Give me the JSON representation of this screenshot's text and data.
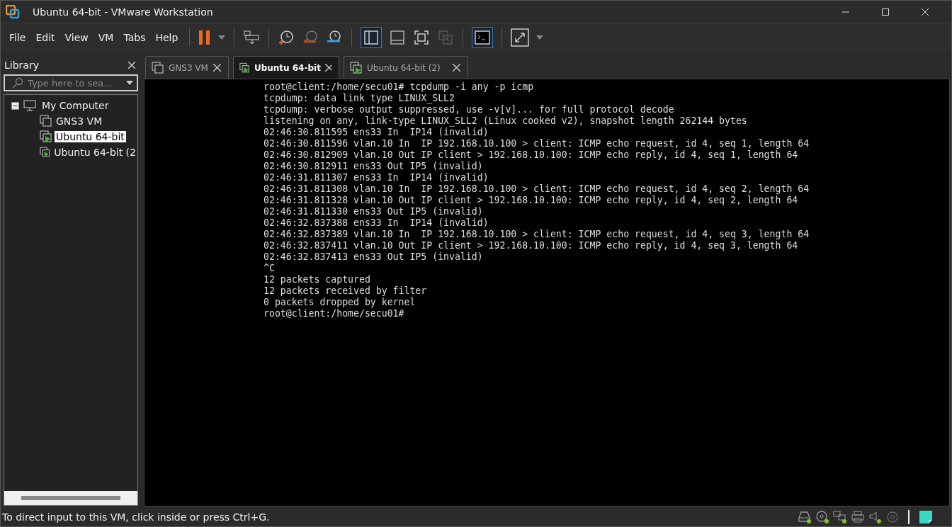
{
  "window": {
    "title": "Ubuntu 64-bit - VMware Workstation"
  },
  "menu": [
    "File",
    "Edit",
    "View",
    "VM",
    "Tabs",
    "Help"
  ],
  "library": {
    "title": "Library",
    "search": {
      "placeholder": "Type here to sea..."
    },
    "tree": [
      {
        "label": "My Computer",
        "kind": "computer",
        "expanded": true,
        "selected": false,
        "children": [
          {
            "label": "GNS3 VM",
            "kind": "vm",
            "running": false,
            "selected": false
          },
          {
            "label": "Ubuntu 64-bit",
            "kind": "vm",
            "running": true,
            "selected": true
          },
          {
            "label": "Ubuntu 64-bit (2",
            "kind": "vm",
            "running": true,
            "selected": false
          }
        ]
      }
    ]
  },
  "tabs": [
    {
      "label": "GNS3 VM",
      "running": false,
      "selected": false
    },
    {
      "label": "Ubuntu 64-bit",
      "running": true,
      "selected": true
    },
    {
      "label": "Ubuntu 64-bit (2)",
      "running": true,
      "selected": false
    }
  ],
  "terminal": {
    "lines": [
      "root@client:/home/secu01# tcpdump -i any -p icmp",
      "tcpdump: data link type LINUX_SLL2",
      "tcpdump: verbose output suppressed, use -v[v]... for full protocol decode",
      "listening on any, link-type LINUX_SLL2 (Linux cooked v2), snapshot length 262144 bytes",
      "02:46:30.811595 ens33 In  IP14 (invalid)",
      "02:46:30.811596 vlan.10 In  IP 192.168.10.100 > client: ICMP echo request, id 4, seq 1, length 64",
      "02:46:30.812909 vlan.10 Out IP client > 192.168.10.100: ICMP echo reply, id 4, seq 1, length 64",
      "02:46:30.812911 ens33 Out IP5 (invalid)",
      "02:46:31.811307 ens33 In  IP14 (invalid)",
      "02:46:31.811308 vlan.10 In  IP 192.168.10.100 > client: ICMP echo request, id 4, seq 2, length 64",
      "02:46:31.811328 vlan.10 Out IP client > 192.168.10.100: ICMP echo reply, id 4, seq 2, length 64",
      "02:46:31.811330 ens33 Out IP5 (invalid)",
      "02:46:32.837388 ens33 In  IP14 (invalid)",
      "02:46:32.837389 vlan.10 In  IP 192.168.10.100 > client: ICMP echo request, id 4, seq 3, length 64",
      "02:46:32.837411 vlan.10 Out IP client > 192.168.10.100: ICMP echo reply, id 4, seq 3, length 64",
      "02:46:32.837413 ens33 Out IP5 (invalid)",
      "^C",
      "12 packets captured",
      "12 packets received by filter",
      "0 packets dropped by kernel",
      "root@client:/home/secu01#"
    ]
  },
  "status_bar": {
    "message": "To direct input to this VM, click inside or press Ctrl+G."
  }
}
